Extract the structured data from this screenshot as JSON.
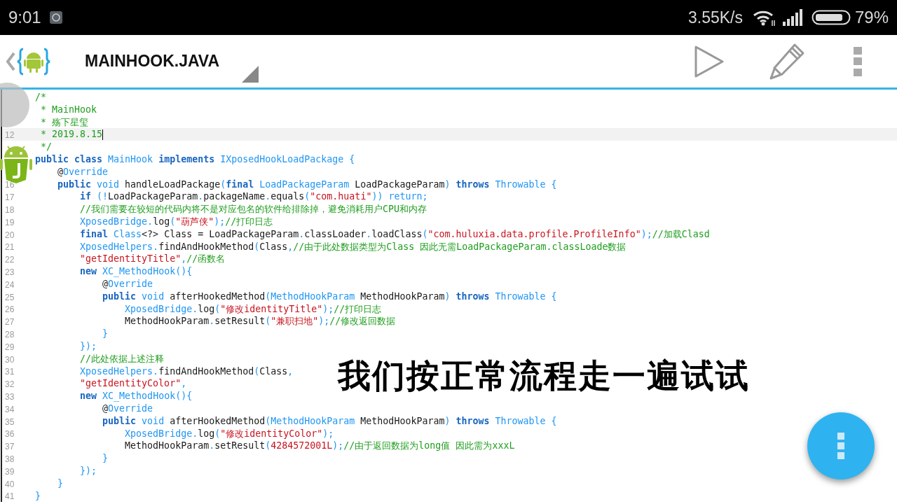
{
  "status_bar": {
    "time": "9:01",
    "speed": "3.55K/s",
    "battery": "79%"
  },
  "toolbar": {
    "title": "MAINHOOK.JAVA"
  },
  "editor": {
    "lines": [
      {
        "current": false,
        "tokens": [
          {
            "kind": "comment",
            "text": "/*"
          }
        ]
      },
      {
        "current": false,
        "tokens": [
          {
            "kind": "comment",
            "text": " * MainHook"
          }
        ]
      },
      {
        "current": false,
        "tokens": [
          {
            "kind": "comment",
            "text": " * 殇下星玺"
          }
        ]
      },
      {
        "number": "12",
        "current": true,
        "tokens": [
          {
            "kind": "comment",
            "text": " * 2019.8.15"
          }
        ]
      },
      {
        "current": false,
        "tokens": [
          {
            "kind": "comment",
            "text": " */"
          }
        ]
      },
      {
        "current": false,
        "tokens": [
          {
            "kind": "keyword",
            "text": "public class "
          },
          {
            "kind": "type",
            "text": "MainHook "
          },
          {
            "kind": "keyword",
            "text": "implements "
          },
          {
            "kind": "type",
            "text": "IXposedHookLoadPackage {"
          }
        ]
      },
      {
        "current": false,
        "tokens": [
          {
            "kind": "plain",
            "text": "    @"
          },
          {
            "kind": "type",
            "text": "Override"
          }
        ]
      },
      {
        "number": "16",
        "current": false,
        "tokens": [
          {
            "kind": "keyword",
            "text": "    public "
          },
          {
            "kind": "type",
            "text": "void "
          },
          {
            "kind": "plain",
            "text": "handleLoadPackage"
          },
          {
            "kind": "symbol",
            "text": "("
          },
          {
            "kind": "keyword",
            "text": "final "
          },
          {
            "kind": "type",
            "text": "LoadPackageParam "
          },
          {
            "kind": "plain",
            "text": "LoadPackageParam"
          },
          {
            "kind": "symbol",
            "text": ") "
          },
          {
            "kind": "keyword",
            "text": "throws "
          },
          {
            "kind": "type",
            "text": "Throwable {"
          }
        ]
      },
      {
        "number": "17",
        "current": false,
        "tokens": [
          {
            "kind": "keyword",
            "text": "        if "
          },
          {
            "kind": "symbol",
            "text": "(!"
          },
          {
            "kind": "plain",
            "text": "LoadPackageParam"
          },
          {
            "kind": "symbol",
            "text": "."
          },
          {
            "kind": "plain",
            "text": "packageName"
          },
          {
            "kind": "symbol",
            "text": "."
          },
          {
            "kind": "plain",
            "text": "equals"
          },
          {
            "kind": "symbol",
            "text": "("
          },
          {
            "kind": "string",
            "text": "\"com.huati\""
          },
          {
            "kind": "symbol",
            "text": ")) "
          },
          {
            "kind": "type",
            "text": "return;"
          }
        ]
      },
      {
        "number": "18",
        "current": false,
        "tokens": [
          {
            "kind": "comment",
            "text": "        //我们需要在较短的代码内将不是对应包名的软件给排除掉，避免消耗用户CPU和内存"
          }
        ]
      },
      {
        "number": "19",
        "current": false,
        "tokens": [
          {
            "kind": "type",
            "text": "        XposedBridge."
          },
          {
            "kind": "plain",
            "text": "log"
          },
          {
            "kind": "symbol",
            "text": "("
          },
          {
            "kind": "string",
            "text": "\"葫芦侠\""
          },
          {
            "kind": "symbol",
            "text": ");"
          },
          {
            "kind": "comment",
            "text": "//打印日志"
          }
        ]
      },
      {
        "number": "20",
        "current": false,
        "tokens": [
          {
            "kind": "keyword",
            "text": "        final "
          },
          {
            "kind": "type",
            "text": "Class"
          },
          {
            "kind": "plain",
            "text": "<?> Class = LoadPackageParam"
          },
          {
            "kind": "symbol",
            "text": "."
          },
          {
            "kind": "plain",
            "text": "classLoader"
          },
          {
            "kind": "symbol",
            "text": "."
          },
          {
            "kind": "plain",
            "text": "loadClass"
          },
          {
            "kind": "symbol",
            "text": "("
          },
          {
            "kind": "string",
            "text": "\"com.huluxia.data.profile.ProfileInfo\""
          },
          {
            "kind": "symbol",
            "text": ");"
          },
          {
            "kind": "comment",
            "text": "//加载Clasd"
          }
        ]
      },
      {
        "number": "21",
        "current": false,
        "tokens": [
          {
            "kind": "type",
            "text": "        XposedHelpers."
          },
          {
            "kind": "plain",
            "text": "findAndHookMethod"
          },
          {
            "kind": "symbol",
            "text": "("
          },
          {
            "kind": "plain",
            "text": "Class"
          },
          {
            "kind": "symbol",
            "text": ","
          },
          {
            "kind": "comment",
            "text": "//由于此处数据类型为Class 因此无需LoadPackageParam.classLoade数据"
          }
        ]
      },
      {
        "number": "22",
        "current": false,
        "tokens": [
          {
            "kind": "string",
            "text": "        \"getIdentityTitle\""
          },
          {
            "kind": "symbol",
            "text": ","
          },
          {
            "kind": "comment",
            "text": "//函数名"
          }
        ]
      },
      {
        "number": "23",
        "current": false,
        "tokens": [
          {
            "kind": "keyword",
            "text": "        new "
          },
          {
            "kind": "type",
            "text": "XC_MethodHook(){"
          }
        ]
      },
      {
        "number": "24",
        "current": false,
        "tokens": [
          {
            "kind": "plain",
            "text": "            @"
          },
          {
            "kind": "type",
            "text": "Override"
          }
        ]
      },
      {
        "number": "25",
        "current": false,
        "tokens": [
          {
            "kind": "keyword",
            "text": "            public "
          },
          {
            "kind": "type",
            "text": "void "
          },
          {
            "kind": "plain",
            "text": "afterHookedMethod"
          },
          {
            "kind": "symbol",
            "text": "("
          },
          {
            "kind": "type",
            "text": "MethodHookParam "
          },
          {
            "kind": "plain",
            "text": "MethodHookParam"
          },
          {
            "kind": "symbol",
            "text": ") "
          },
          {
            "kind": "keyword",
            "text": "throws "
          },
          {
            "kind": "type",
            "text": "Throwable {"
          }
        ]
      },
      {
        "number": "26",
        "current": false,
        "tokens": [
          {
            "kind": "type",
            "text": "                XposedBridge."
          },
          {
            "kind": "plain",
            "text": "log"
          },
          {
            "kind": "symbol",
            "text": "("
          },
          {
            "kind": "string",
            "text": "\"修改identityTitle\""
          },
          {
            "kind": "symbol",
            "text": ");"
          },
          {
            "kind": "comment",
            "text": "//打印日志"
          }
        ]
      },
      {
        "number": "27",
        "current": false,
        "tokens": [
          {
            "kind": "plain",
            "text": "                MethodHookParam"
          },
          {
            "kind": "symbol",
            "text": "."
          },
          {
            "kind": "plain",
            "text": "setResult"
          },
          {
            "kind": "symbol",
            "text": "("
          },
          {
            "kind": "string",
            "text": "\"兼职扫地\""
          },
          {
            "kind": "symbol",
            "text": ");"
          },
          {
            "kind": "comment",
            "text": "//修改返回数据"
          }
        ]
      },
      {
        "number": "28",
        "current": false,
        "tokens": [
          {
            "kind": "symbol",
            "text": "            }"
          }
        ]
      },
      {
        "number": "29",
        "current": false,
        "tokens": [
          {
            "kind": "symbol",
            "text": "        });"
          }
        ]
      },
      {
        "number": "30",
        "current": false,
        "tokens": [
          {
            "kind": "comment",
            "text": "        //此处依据上述注释"
          }
        ]
      },
      {
        "number": "31",
        "current": false,
        "tokens": [
          {
            "kind": "type",
            "text": "        XposedHelpers."
          },
          {
            "kind": "plain",
            "text": "findAndHookMethod"
          },
          {
            "kind": "symbol",
            "text": "("
          },
          {
            "kind": "plain",
            "text": "Class"
          },
          {
            "kind": "symbol",
            "text": ","
          }
        ]
      },
      {
        "number": "32",
        "current": false,
        "tokens": [
          {
            "kind": "string",
            "text": "        \"getIdentityColor\""
          },
          {
            "kind": "symbol",
            "text": ","
          }
        ]
      },
      {
        "number": "33",
        "current": false,
        "tokens": [
          {
            "kind": "keyword",
            "text": "        new "
          },
          {
            "kind": "type",
            "text": "XC_MethodHook(){"
          }
        ]
      },
      {
        "number": "34",
        "current": false,
        "tokens": [
          {
            "kind": "plain",
            "text": "            @"
          },
          {
            "kind": "type",
            "text": "Override"
          }
        ]
      },
      {
        "number": "35",
        "current": false,
        "tokens": [
          {
            "kind": "keyword",
            "text": "            public "
          },
          {
            "kind": "type",
            "text": "void "
          },
          {
            "kind": "plain",
            "text": "afterHookedMethod"
          },
          {
            "kind": "symbol",
            "text": "("
          },
          {
            "kind": "type",
            "text": "MethodHookParam "
          },
          {
            "kind": "plain",
            "text": "MethodHookParam"
          },
          {
            "kind": "symbol",
            "text": ") "
          },
          {
            "kind": "keyword",
            "text": "throws "
          },
          {
            "kind": "type",
            "text": "Throwable {"
          }
        ]
      },
      {
        "number": "36",
        "current": false,
        "tokens": [
          {
            "kind": "type",
            "text": "                XposedBridge."
          },
          {
            "kind": "plain",
            "text": "log"
          },
          {
            "kind": "symbol",
            "text": "("
          },
          {
            "kind": "string",
            "text": "\"修改identityColor\""
          },
          {
            "kind": "symbol",
            "text": ");"
          }
        ]
      },
      {
        "number": "37",
        "current": false,
        "tokens": [
          {
            "kind": "plain",
            "text": "                MethodHookParam"
          },
          {
            "kind": "symbol",
            "text": "."
          },
          {
            "kind": "plain",
            "text": "setResult"
          },
          {
            "kind": "symbol",
            "text": "("
          },
          {
            "kind": "string",
            "text": "4284572001L"
          },
          {
            "kind": "symbol",
            "text": ");"
          },
          {
            "kind": "comment",
            "text": "//由于返回数据为long值 因此需为xxxL"
          }
        ]
      },
      {
        "number": "38",
        "current": false,
        "tokens": [
          {
            "kind": "symbol",
            "text": "            }"
          }
        ]
      },
      {
        "number": "39",
        "current": false,
        "tokens": [
          {
            "kind": "symbol",
            "text": "        });"
          }
        ]
      },
      {
        "number": "40",
        "current": false,
        "tokens": [
          {
            "kind": "symbol",
            "text": "    }"
          }
        ]
      },
      {
        "number": "41",
        "current": false,
        "tokens": [
          {
            "kind": "symbol",
            "text": "}"
          }
        ]
      }
    ]
  },
  "caption": "我们按正常流程走一遍试试"
}
